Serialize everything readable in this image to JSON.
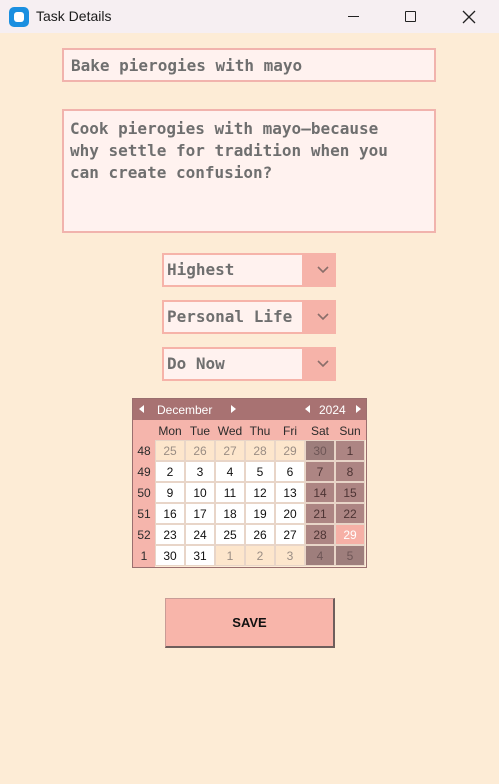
{
  "window": {
    "title": "Task Details"
  },
  "task": {
    "title": "Bake pierogies with mayo",
    "description": "Cook pierogies with mayo—because\nwhy settle for tradition when you\ncan create confusion?"
  },
  "dropdowns": {
    "priority": "Highest",
    "category": "Personal Life",
    "urgency": "Do Now"
  },
  "calendar": {
    "month": "December",
    "year": "2024",
    "day_headers": [
      "Mon",
      "Tue",
      "Wed",
      "Thu",
      "Fri",
      "Sat",
      "Sun"
    ],
    "week_numbers": [
      "48",
      "49",
      "50",
      "51",
      "52",
      "1"
    ],
    "weeks": [
      [
        "25",
        "26",
        "27",
        "28",
        "29",
        "30",
        "1"
      ],
      [
        "2",
        "3",
        "4",
        "5",
        "6",
        "7",
        "8"
      ],
      [
        "9",
        "10",
        "11",
        "12",
        "13",
        "14",
        "15"
      ],
      [
        "16",
        "17",
        "18",
        "19",
        "20",
        "21",
        "22"
      ],
      [
        "23",
        "24",
        "25",
        "26",
        "27",
        "28",
        "29"
      ],
      [
        "30",
        "31",
        "1",
        "2",
        "3",
        "4",
        "5"
      ]
    ],
    "selected_date": "29"
  },
  "buttons": {
    "save": "SAVE"
  },
  "colors": {
    "background": "#fdecd6",
    "field_border": "#f1b3ad",
    "field_fill": "#fff2ef",
    "calendar_header": "#a87272",
    "button": "#f8b5aa"
  }
}
